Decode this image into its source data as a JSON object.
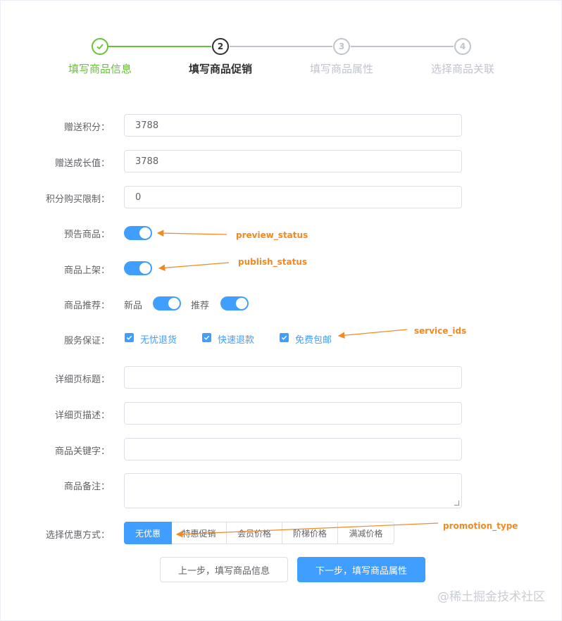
{
  "steps": [
    {
      "title": "填写商品信息",
      "number": "1",
      "state": "done"
    },
    {
      "title": "填写商品促销",
      "number": "2",
      "state": "process"
    },
    {
      "title": "填写商品属性",
      "number": "3",
      "state": "wait"
    },
    {
      "title": "选择商品关联",
      "number": "4",
      "state": "wait"
    }
  ],
  "form": {
    "gift_point": {
      "label": "赠送积分：",
      "value": "3788"
    },
    "gift_growth": {
      "label": "赠送成长值：",
      "value": "3788"
    },
    "use_point_limit": {
      "label": "积分购买限制：",
      "value": "0"
    },
    "preview_status": {
      "label": "预告商品：",
      "on": true
    },
    "publish_status": {
      "label": "商品上架：",
      "on": true
    },
    "recommend": {
      "label": "商品推荐：",
      "new_label": "新品",
      "new_on": true,
      "recommend_label": "推荐",
      "recommend_on": true
    },
    "service": {
      "label": "服务保证：",
      "options": [
        {
          "label": "无忧退货",
          "checked": true
        },
        {
          "label": "快速退款",
          "checked": true
        },
        {
          "label": "免费包邮",
          "checked": true
        }
      ]
    },
    "detail_title": {
      "label": "详细页标题：",
      "value": ""
    },
    "detail_desc": {
      "label": "详细页描述：",
      "value": ""
    },
    "keywords": {
      "label": "商品关键字：",
      "value": ""
    },
    "note": {
      "label": "商品备注：",
      "value": ""
    },
    "promotion": {
      "label": "选择优惠方式：",
      "options": [
        "无优惠",
        "特惠促销",
        "会员价格",
        "阶梯价格",
        "满减价格"
      ],
      "selected": "无优惠"
    }
  },
  "buttons": {
    "prev": "上一步，填写商品信息",
    "next": "下一步，填写商品属性"
  },
  "annotations": {
    "preview_status": "preview_status",
    "publish_status": "publish_status",
    "service_ids": "service_ids",
    "promotion_type": "promotion_type"
  },
  "colors": {
    "primary": "#409eff",
    "success": "#67c23a",
    "annotation": "#f08a24"
  },
  "watermark": "@稀土掘金技术社区"
}
